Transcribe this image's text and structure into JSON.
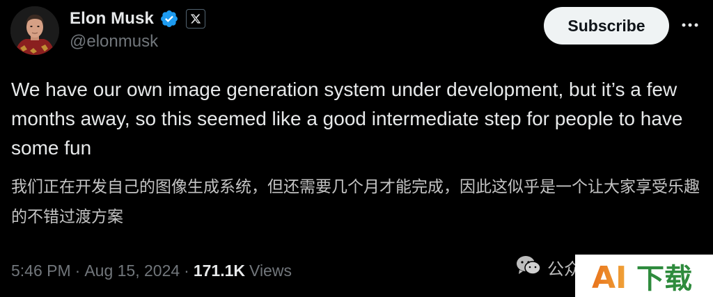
{
  "author": {
    "display_name": "Elon Musk",
    "handle": "@elonmusk",
    "avatar_icon": "avatar-photo",
    "verified_icon": "verified-badge-icon",
    "affiliation_icon": "x-logo-icon"
  },
  "actions": {
    "subscribe_label": "Subscribe",
    "more_icon": "more-dots-icon"
  },
  "tweet": {
    "text": "We have our own image generation system under development, but it’s a few months away, so this seemed like a good intermediate step for people to have some fun",
    "translation": "我们正在开发自己的图像生成系统，但还需要几个月才能完成，因此这似乎是一个让大家享受乐趣的不错过渡方案"
  },
  "meta": {
    "time": "5:46 PM",
    "separator": "·",
    "date": "Aug 15, 2024",
    "views_count": "171.1K",
    "views_label": "Views"
  },
  "watermark": {
    "wechat_text": "公众",
    "logo_text_ai": "AI",
    "logo_text_cn": "下载"
  },
  "colors": {
    "background": "#000000",
    "primary_text": "#e7e9ea",
    "secondary_text": "#71767b",
    "verified_blue": "#1d9bf0",
    "subscribe_bg": "#eff3f4",
    "logo_orange": "#e8731c",
    "logo_green": "#2e8b3d"
  }
}
